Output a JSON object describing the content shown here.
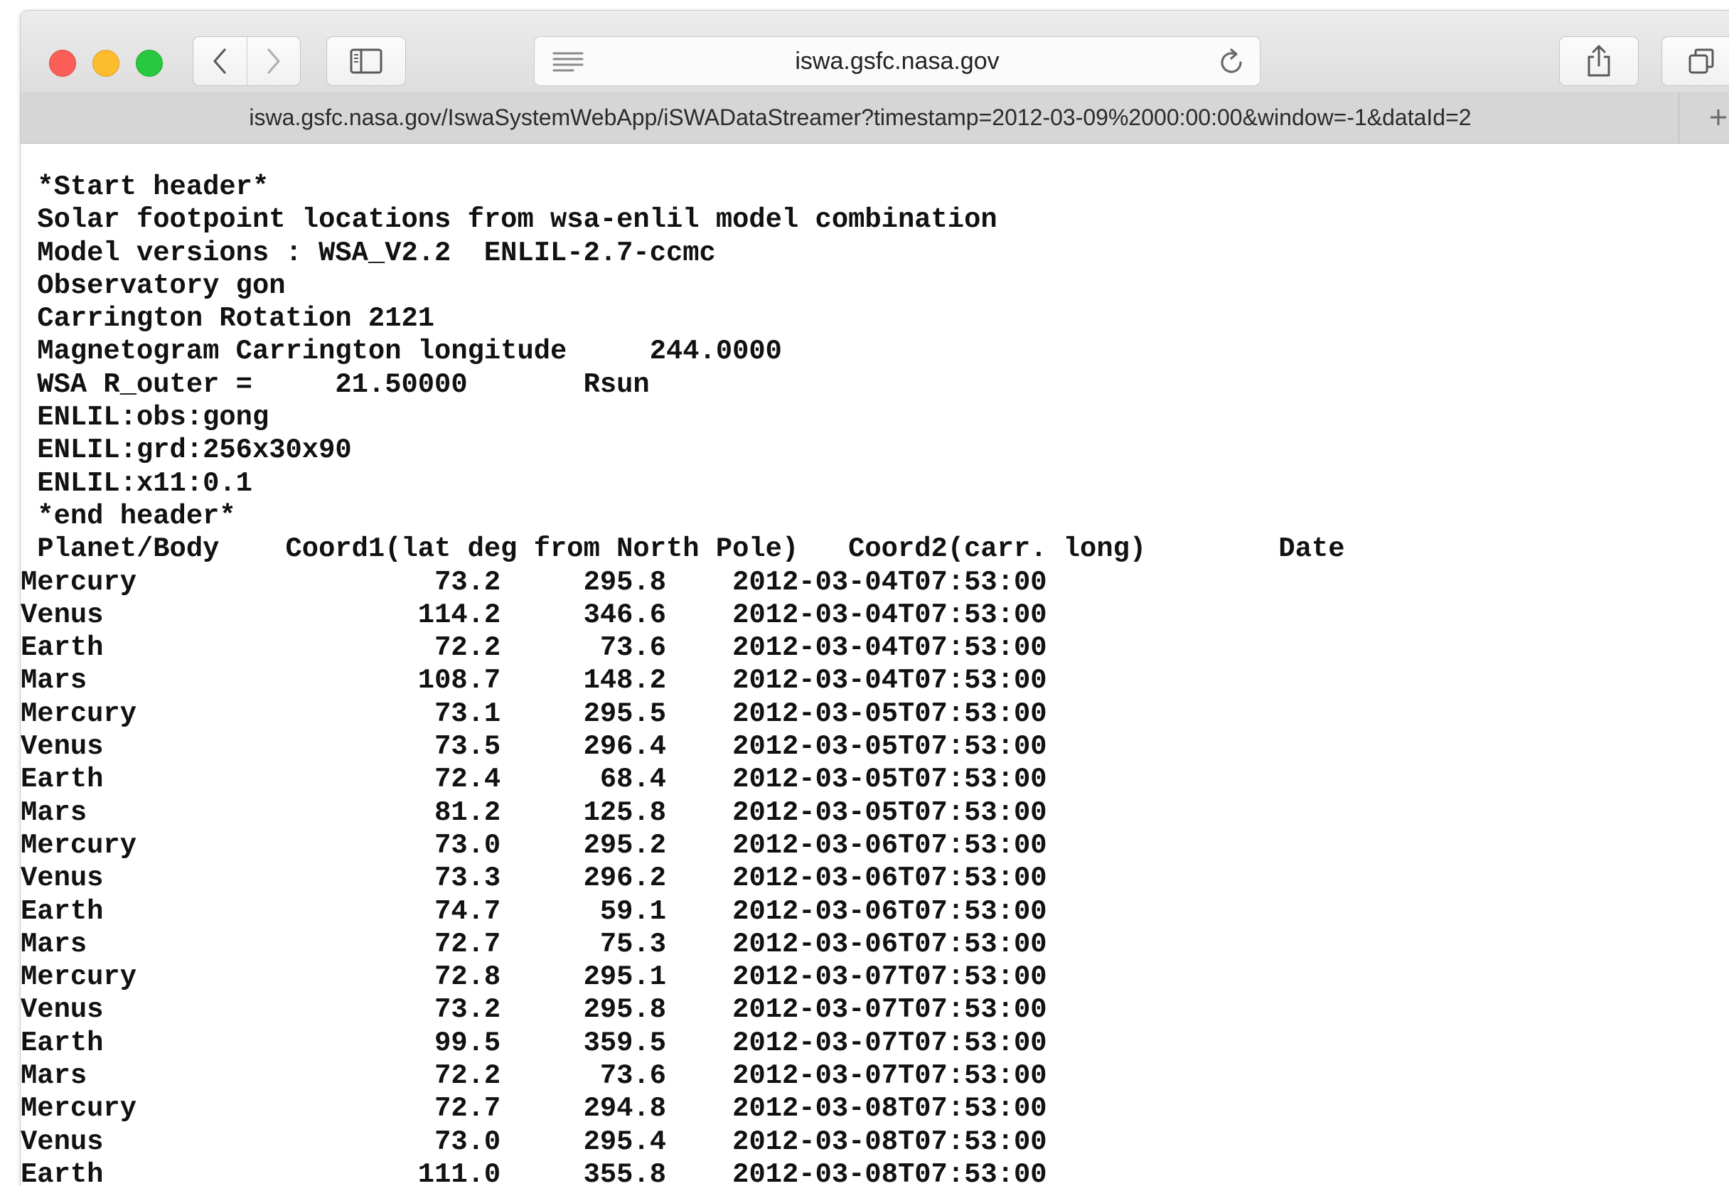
{
  "browser": {
    "host": "iswa.gsfc.nasa.gov",
    "url": "iswa.gsfc.nasa.gov/IswaSystemWebApp/iSWADataStreamer?timestamp=2012-03-09%2000:00:00&window=-1&dataId=2",
    "icons": {
      "back": "chevron-left-icon",
      "forward": "chevron-right-icon",
      "sidebar": "sidebar-icon",
      "reader": "reader-lines-icon",
      "reload": "reload-icon",
      "share": "share-icon",
      "tabs": "tabs-overview-icon",
      "new_tab": "plus-icon"
    }
  },
  "document": {
    "header_lines": [
      " *Start header*",
      " Solar footpoint locations from wsa-enlil model combination",
      " Model versions : WSA_V2.2  ENLIL-2.7-ccmc",
      " Observatory gon",
      " Carrington Rotation 2121",
      " Magnetogram Carrington longitude     244.0000",
      " WSA R_outer =     21.50000       Rsun",
      " ENLIL:obs:gong",
      " ENLIL:grd:256x30x90",
      " ENLIL:x11:0.1",
      " *end header*",
      " Planet/Body    Coord1(lat deg from North Pole)   Coord2(carr. long)        Date"
    ],
    "rows": [
      {
        "body": "Mercury",
        "coord1": "73.2",
        "coord2": "295.8",
        "date": "2012-03-04T07:53:00"
      },
      {
        "body": "Venus",
        "coord1": "114.2",
        "coord2": "346.6",
        "date": "2012-03-04T07:53:00"
      },
      {
        "body": "Earth",
        "coord1": "72.2",
        "coord2": "73.6",
        "date": "2012-03-04T07:53:00"
      },
      {
        "body": "Mars",
        "coord1": "108.7",
        "coord2": "148.2",
        "date": "2012-03-04T07:53:00"
      },
      {
        "body": "Mercury",
        "coord1": "73.1",
        "coord2": "295.5",
        "date": "2012-03-05T07:53:00"
      },
      {
        "body": "Venus",
        "coord1": "73.5",
        "coord2": "296.4",
        "date": "2012-03-05T07:53:00"
      },
      {
        "body": "Earth",
        "coord1": "72.4",
        "coord2": "68.4",
        "date": "2012-03-05T07:53:00"
      },
      {
        "body": "Mars",
        "coord1": "81.2",
        "coord2": "125.8",
        "date": "2012-03-05T07:53:00"
      },
      {
        "body": "Mercury",
        "coord1": "73.0",
        "coord2": "295.2",
        "date": "2012-03-06T07:53:00"
      },
      {
        "body": "Venus",
        "coord1": "73.3",
        "coord2": "296.2",
        "date": "2012-03-06T07:53:00"
      },
      {
        "body": "Earth",
        "coord1": "74.7",
        "coord2": "59.1",
        "date": "2012-03-06T07:53:00"
      },
      {
        "body": "Mars",
        "coord1": "72.7",
        "coord2": "75.3",
        "date": "2012-03-06T07:53:00"
      },
      {
        "body": "Mercury",
        "coord1": "72.8",
        "coord2": "295.1",
        "date": "2012-03-07T07:53:00"
      },
      {
        "body": "Venus",
        "coord1": "73.2",
        "coord2": "295.8",
        "date": "2012-03-07T07:53:00"
      },
      {
        "body": "Earth",
        "coord1": "99.5",
        "coord2": "359.5",
        "date": "2012-03-07T07:53:00"
      },
      {
        "body": "Mars",
        "coord1": "72.2",
        "coord2": "73.6",
        "date": "2012-03-07T07:53:00"
      },
      {
        "body": "Mercury",
        "coord1": "72.7",
        "coord2": "294.8",
        "date": "2012-03-08T07:53:00"
      },
      {
        "body": "Venus",
        "coord1": "73.0",
        "coord2": "295.4",
        "date": "2012-03-08T07:53:00"
      },
      {
        "body": "Earth",
        "coord1": "111.0",
        "coord2": "355.8",
        "date": "2012-03-08T07:53:00"
      }
    ]
  }
}
